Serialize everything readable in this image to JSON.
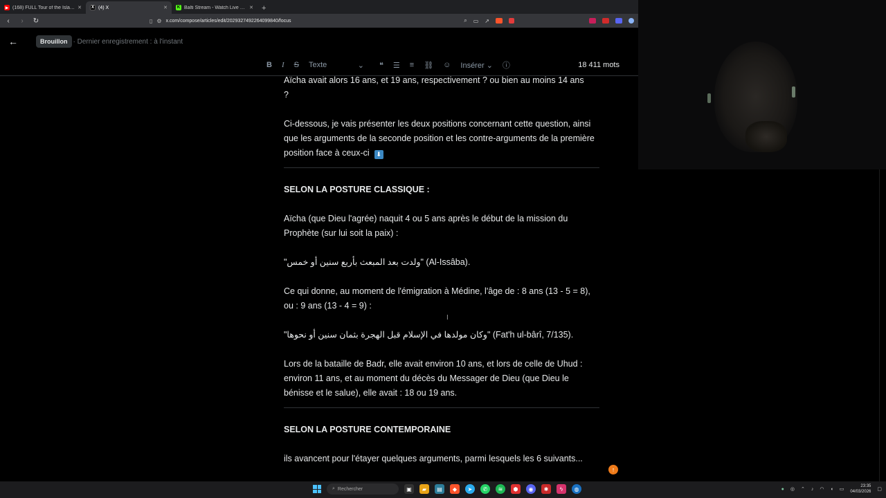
{
  "browser": {
    "tabs": [
      {
        "label": "(168) FULL Tour of the Islamic Univer",
        "favicon": "youtube-icon",
        "color": "#ff0000",
        "active": false
      },
      {
        "label": "(4) X",
        "favicon": "x-icon",
        "color": "#000000",
        "active": true
      },
      {
        "label": "Balti Stream - Watch Live on Kick",
        "favicon": "kick-icon",
        "color": "#53fc18",
        "active": false
      }
    ],
    "new_tab_symbol": "+",
    "url": "x.com/compose/articles/edit/2029327492264099840/focus"
  },
  "editor": {
    "draft_badge": "Brouillon",
    "last_saved": "· Dernier enregistrement : à l'instant",
    "toolbar": {
      "bold": "B",
      "italic": "I",
      "strike": "S",
      "style_select": "Texte",
      "insert_menu": "Insérer",
      "word_count": "18 411 mots"
    },
    "paragraphs": {
      "p1a": "Aïcha avait alors 16 ans, et 19 ans, respectivement ? ou bien au moins 14 ans",
      "p1b": "?",
      "p2": "Ci-dessous, je vais présenter les deux positions concernant cette question, ainsi que les arguments de la seconde position et les contre-arguments de la première position face à ceux-ci",
      "emoji": "⬇",
      "h1": "SELON LA POSTURE CLASSIQUE :",
      "p3": "Aïcha (que Dieu l'agrée) naquit 4 ou 5 ans après le début de la mission du Prophète (sur lui soit la paix) :",
      "q1_ar": "\"ولدت بعد المبعث بأربع سنين أو خمس\"",
      "q1_src": " (Al-Issâba).",
      "p4": "Ce qui donne, au moment de l'émigration à Médine, l'âge de : 8 ans (13 - 5 = 8), ou : 9 ans (13 - 4 = 9) :",
      "q2_ar": " \"وكان مولدها في الإسلام قبل الهجرة بثمان سنين أو نحوها\"",
      "q2_src": " (Fat'h ul-bârî, 7/135).",
      "p5": "Lors de la bataille de Badr, elle avait environ 10 ans, et lors de celle de Uhud : environ 11 ans, et au moment du décès du Messager de Dieu (que Dieu le bénisse et le salue), elle avait : 18 ou 19 ans.",
      "h2": "SELON LA POSTURE CONTEMPORAINE",
      "p6": "ils avancent pour l'étayer quelques arguments, parmi lesquels les 6 suivants..."
    }
  },
  "taskbar": {
    "search_placeholder": "Rechercher",
    "time": "23:35",
    "date": "04/03/2026"
  }
}
